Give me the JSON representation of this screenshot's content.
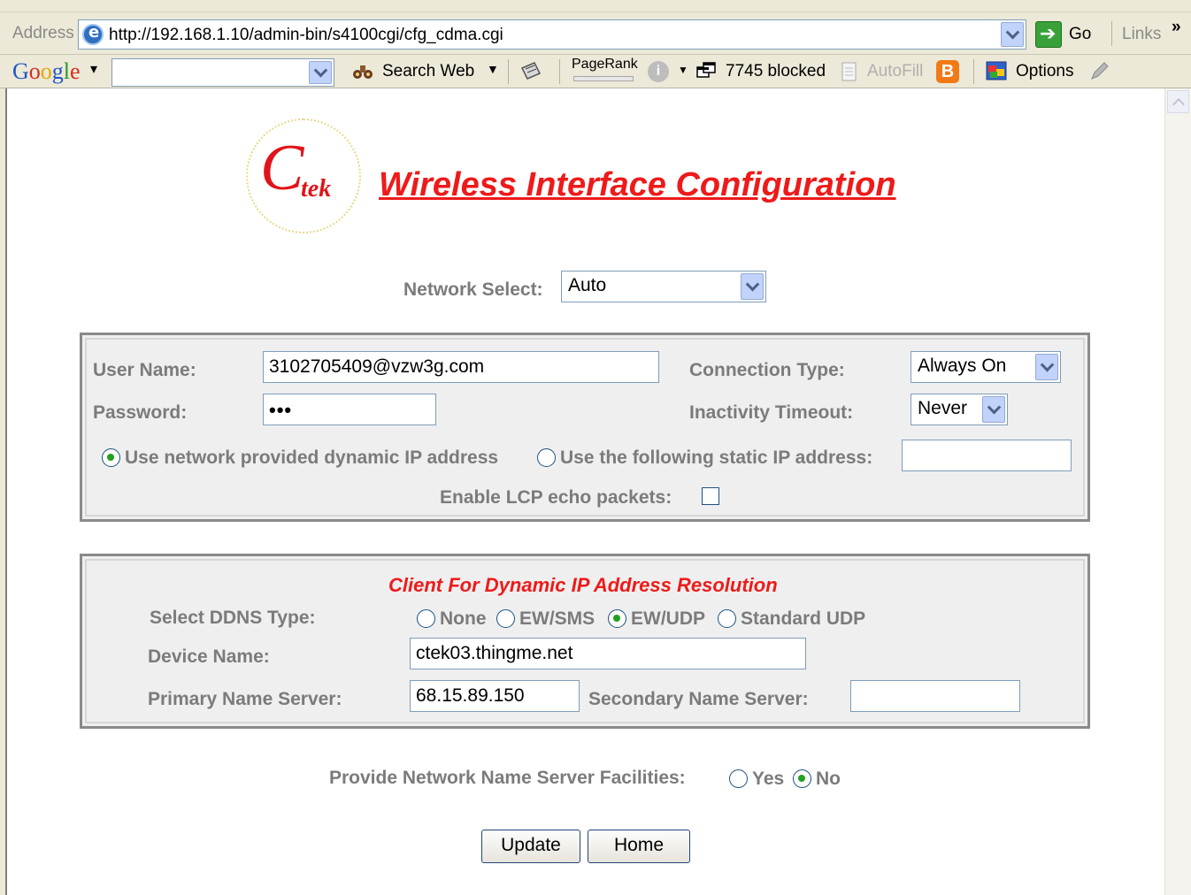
{
  "browser": {
    "address_label": "Address",
    "url": "http://192.168.1.10/admin-bin/s4100cgi/cfg_cdma.cgi",
    "go_label": "Go",
    "links_label": "Links",
    "chevron": "»"
  },
  "google_toolbar": {
    "logo_text": "Google",
    "search_value": "",
    "search_web_label": "Search Web",
    "pagerank_label": "PageRank",
    "blocked_label": "7745 blocked",
    "autofill_label": "AutoFill",
    "options_label": "Options"
  },
  "page": {
    "logo_letter": "C",
    "logo_suffix": "tek",
    "title": "Wireless Interface Configuration",
    "network_select_label": "Network Select:",
    "network_select_value": "Auto"
  },
  "connection_panel": {
    "username_label": "User Name:",
    "username_value": "3102705409@vzw3g.com",
    "password_label": "Password:",
    "password_value": "•••",
    "connection_type_label": "Connection Type:",
    "connection_type_value": "Always On",
    "inactivity_label": "Inactivity Timeout:",
    "inactivity_value": "Never",
    "dynamic_ip_label": "Use network provided dynamic IP address",
    "static_ip_label": "Use the following static IP address:",
    "static_ip_value": "",
    "ip_mode_selected": "dynamic",
    "lcp_label": "Enable LCP echo packets:",
    "lcp_checked": false
  },
  "ddns_panel": {
    "heading": "Client For Dynamic IP Address Resolution",
    "ddns_type_label": "Select DDNS Type:",
    "ddns_options": [
      "None",
      "EW/SMS",
      "EW/UDP",
      "Standard UDP"
    ],
    "ddns_selected": "EW/UDP",
    "device_name_label": "Device Name:",
    "device_name_value": "ctek03.thingme.net",
    "primary_ns_label": "Primary Name Server:",
    "primary_ns_value": "68.15.89.150",
    "secondary_ns_label": "Secondary Name Server:",
    "secondary_ns_value": ""
  },
  "footer": {
    "ns_facilities_label": "Provide Network Name Server Facilities:",
    "yes_label": "Yes",
    "no_label": "No",
    "ns_facilities_selected": "No",
    "update_label": "Update",
    "home_label": "Home"
  },
  "colors": {
    "title_red": "#ee1a1a",
    "label_gray": "#7b7b7b",
    "radio_green": "#21a121",
    "chrome_bg": "#ece9d8"
  }
}
